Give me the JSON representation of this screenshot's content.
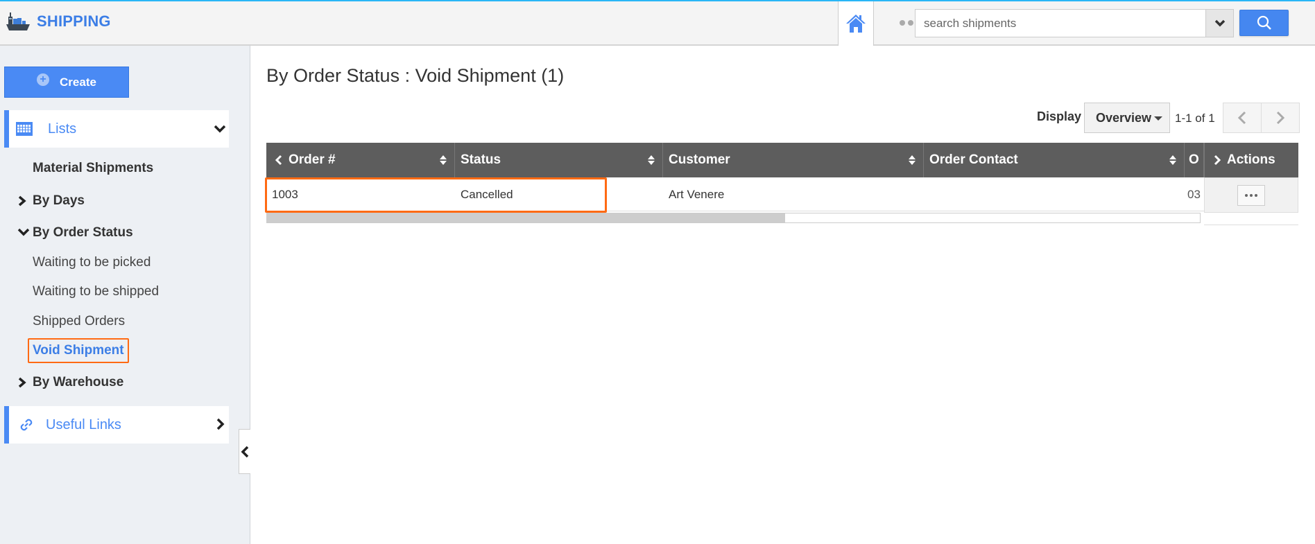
{
  "header": {
    "app_title": "SHIPPING",
    "search_placeholder": "search shipments",
    "icons": {
      "logo": "ship-icon",
      "home": "home-icon",
      "more": "more-dots-icon",
      "search_dropdown": "chevron-down-icon",
      "search": "search-icon"
    }
  },
  "sidebar": {
    "create_label": "Create",
    "lists_label": "Lists",
    "items": [
      {
        "label": "Material Shipments",
        "level": 0,
        "bold": true
      },
      {
        "label": "By Days",
        "level": 0,
        "bold": true,
        "expanded": false
      },
      {
        "label": "By Order Status",
        "level": 0,
        "bold": true,
        "expanded": true
      },
      {
        "label": "Waiting to be picked",
        "level": 1
      },
      {
        "label": "Waiting to be shipped",
        "level": 1
      },
      {
        "label": "Shipped Orders",
        "level": 1
      },
      {
        "label": "Void Shipment",
        "level": 1,
        "active": true
      },
      {
        "label": "By Warehouse",
        "level": 0,
        "bold": true,
        "expanded": false
      }
    ],
    "useful_links_label": "Useful Links"
  },
  "main": {
    "page_title": "By Order Status : Void Shipment (1)",
    "display_label": "Display",
    "display_value": "Overview",
    "pager_text": "1-1 of 1",
    "table": {
      "columns": [
        "Order #",
        "Status",
        "Customer",
        "Order Contact",
        "O"
      ],
      "actions_header": "Actions",
      "rows": [
        {
          "order": "1003",
          "status": "Cancelled",
          "customer": "Art Venere",
          "order_contact": "",
          "o": "03"
        }
      ]
    }
  },
  "colors": {
    "accent": "#4a8af4",
    "brand_text": "#3c7ee6",
    "highlight": "#ff6a13",
    "table_header": "#5d5d5d"
  }
}
